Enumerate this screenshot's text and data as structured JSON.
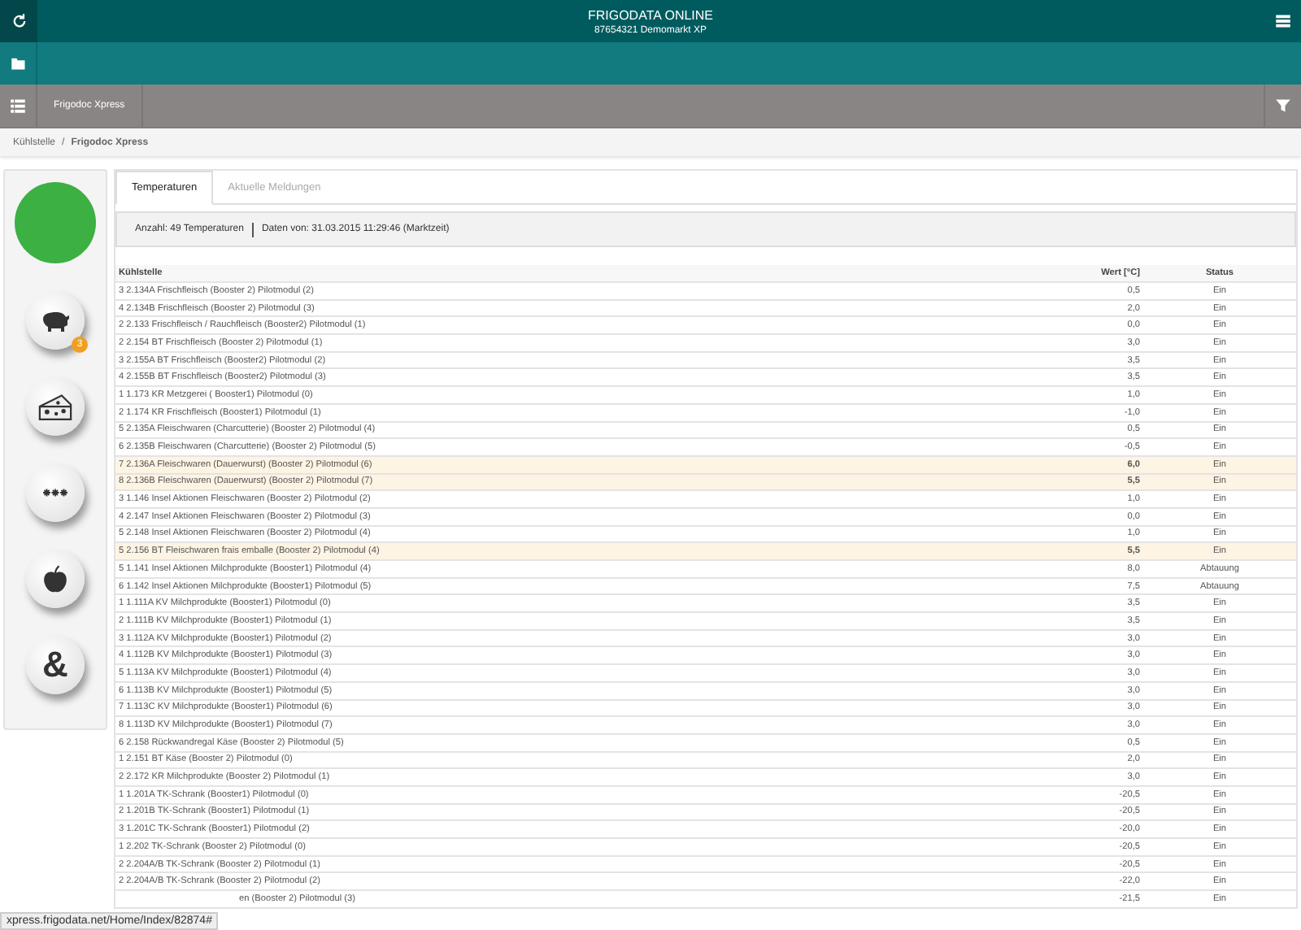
{
  "header": {
    "title": "FRIGODATA ONLINE",
    "subtitle": "87654321 Demomarkt XP"
  },
  "nav_tab": "Frigodoc Xpress",
  "breadcrumb": [
    "Kühlstelle",
    "/",
    "Frigodoc Xpress"
  ],
  "sidebar": {
    "status": {
      "color": "#3cb043"
    },
    "buttons": [
      {
        "kind": "pig",
        "badge": "3"
      },
      {
        "kind": "cheese"
      },
      {
        "kind": "snow"
      },
      {
        "kind": "apple"
      },
      {
        "kind": "text",
        "label": "&"
      }
    ]
  },
  "tabs": [
    {
      "label": "Temperaturen",
      "selected": true
    },
    {
      "label": "Aktuelle Meldungen",
      "selected": false
    }
  ],
  "info": {
    "count": "Anzahl: 49 Temperaturen",
    "date": "Daten von: 31.03.2015 11:29:46 (Marktzeit)"
  },
  "table": {
    "columns": [
      "Kühlstelle",
      "Wert [°C]",
      "Status"
    ],
    "rows": [
      {
        "name": "3 2.134A Frischfleisch (Booster 2) Pilotmodul (2)",
        "value": "0,5",
        "status": "Ein",
        "highlighted": false
      },
      {
        "name": "4 2.134B Frischfleisch (Booster 2) Pilotmodul (3)",
        "value": "2,0",
        "status": "Ein",
        "highlighted": false
      },
      {
        "name": "2 2.133 Frischfleisch / Rauchfleisch (Booster2) Pilotmodul (1)",
        "value": "0,0",
        "status": "Ein",
        "highlighted": false
      },
      {
        "name": "2 2.154 BT Frischfleisch (Booster 2) Pilotmodul (1)",
        "value": "3,0",
        "status": "Ein",
        "highlighted": false
      },
      {
        "name": "3 2.155A BT Frischfleisch (Booster2) Pilotmodul (2)",
        "value": "3,5",
        "status": "Ein",
        "highlighted": false
      },
      {
        "name": "4 2.155B BT Frischfleisch (Booster2) Pilotmodul (3)",
        "value": "3,5",
        "status": "Ein",
        "highlighted": false
      },
      {
        "name": "1 1.173 KR Metzgerei ( Booster1) Pilotmodul (0)",
        "value": "1,0",
        "status": "Ein",
        "highlighted": false
      },
      {
        "name": "2 1.174 KR Frischfleisch (Booster1) Pilotmodul (1)",
        "value": "-1,0",
        "status": "Ein",
        "highlighted": false
      },
      {
        "name": "5 2.135A Fleischwaren (Charcutterie) (Booster 2) Pilotmodul (4)",
        "value": "0,5",
        "status": "Ein",
        "highlighted": false
      },
      {
        "name": "6 2.135B Fleischwaren (Charcutterie) (Booster 2) Pilotmodul (5)",
        "value": "-0,5",
        "status": "Ein",
        "highlighted": false
      },
      {
        "name": "7 2.136A Fleischwaren (Dauerwurst) (Booster 2) Pilotmodul (6)",
        "value": "6,0",
        "status": "Ein",
        "highlighted": true
      },
      {
        "name": "8 2.136B Fleischwaren (Dauerwurst) (Booster 2) Pilotmodul (7)",
        "value": "5,5",
        "status": "Ein",
        "highlighted": true
      },
      {
        "name": "3 1.146 Insel Aktionen Fleischwaren (Booster 2) Pilotmodul (2)",
        "value": "1,0",
        "status": "Ein",
        "highlighted": false
      },
      {
        "name": "4 2.147 Insel Aktionen Fleischwaren (Booster 2) Pilotmodul (3)",
        "value": "0,0",
        "status": "Ein",
        "highlighted": false
      },
      {
        "name": "5 2.148 Insel Aktionen Fleischwaren (Booster 2) Pilotmodul (4)",
        "value": "1,0",
        "status": "Ein",
        "highlighted": false
      },
      {
        "name": "5 2.156 BT Fleischwaren frais emballe (Booster 2) Pilotmodul (4)",
        "value": "5,5",
        "status": "Ein",
        "highlighted": true
      },
      {
        "name": "5 1.141 Insel Aktionen Milchprodukte (Booster1) Pilotmodul (4)",
        "value": "8,0",
        "status": "Abtauung",
        "highlighted": false
      },
      {
        "name": "6 1.142 Insel Aktionen Milchprodukte (Booster1) Pilotmodul (5)",
        "value": "7,5",
        "status": "Abtauung",
        "highlighted": false
      },
      {
        "name": "1 1.111A KV Milchprodukte (Booster1) Pilotmodul (0)",
        "value": "3,5",
        "status": "Ein",
        "highlighted": false
      },
      {
        "name": "2 1.111B KV Milchprodukte (Booster1) Pilotmodul (1)",
        "value": "3,5",
        "status": "Ein",
        "highlighted": false
      },
      {
        "name": "3 1.112A KV Milchprodukte (Booster1) Pilotmodul (2)",
        "value": "3,0",
        "status": "Ein",
        "highlighted": false
      },
      {
        "name": "4 1.112B KV Milchprodukte (Booster1) Pilotmodul (3)",
        "value": "3,0",
        "status": "Ein",
        "highlighted": false
      },
      {
        "name": "5 1.113A KV Milchprodukte (Booster1) Pilotmodul (4)",
        "value": "3,0",
        "status": "Ein",
        "highlighted": false
      },
      {
        "name": "6 1.113B KV Milchprodukte (Booster1) Pilotmodul (5)",
        "value": "3,0",
        "status": "Ein",
        "highlighted": false
      },
      {
        "name": "7 1.113C KV Milchprodukte (Booster1) Pilotmodul (6)",
        "value": "3,0",
        "status": "Ein",
        "highlighted": false
      },
      {
        "name": "8 1.113D KV Milchprodukte (Booster1) Pilotmodul (7)",
        "value": "3,0",
        "status": "Ein",
        "highlighted": false
      },
      {
        "name": "6 2.158 Rückwandregal Käse (Booster 2) Pilotmodul (5)",
        "value": "0,5",
        "status": "Ein",
        "highlighted": false
      },
      {
        "name": "1 2.151 BT Käse (Booster 2) Pilotmodul (0)",
        "value": "2,0",
        "status": "Ein",
        "highlighted": false
      },
      {
        "name": "2 2.172 KR Milchprodukte (Booster 2) Pilotmodul (1)",
        "value": "3,0",
        "status": "Ein",
        "highlighted": false
      },
      {
        "name": "1 1.201A TK-Schrank (Booster1) Pilotmodul (0)",
        "value": "-20,5",
        "status": "Ein",
        "highlighted": false
      },
      {
        "name": "2 1.201B TK-Schrank (Booster1) Pilotmodul (1)",
        "value": "-20,5",
        "status": "Ein",
        "highlighted": false
      },
      {
        "name": "3 1.201C TK-Schrank (Booster1) Pilotmodul (2)",
        "value": "-20,0",
        "status": "Ein",
        "highlighted": false
      },
      {
        "name": "1 2.202 TK-Schrank (Booster 2) Pilotmodul (0)",
        "value": "-20,5",
        "status": "Ein",
        "highlighted": false
      },
      {
        "name": "2 2.204A/B TK-Schrank (Booster 2) Pilotmodul (1)",
        "value": "-20,5",
        "status": "Ein",
        "highlighted": false
      },
      {
        "name": "2 2.204A/B TK-Schrank (Booster 2) Pilotmodul (2)",
        "value": "-22,0",
        "status": "Ein",
        "highlighted": false
      },
      {
        "kind": "covered",
        "name": "en (Booster 2) Pilotmodul (3)",
        "value": "-21,5",
        "status": "Ein",
        "highlighted": false
      }
    ]
  },
  "status_bar": "xpress.frigodata.net/Home/Index/82874#"
}
